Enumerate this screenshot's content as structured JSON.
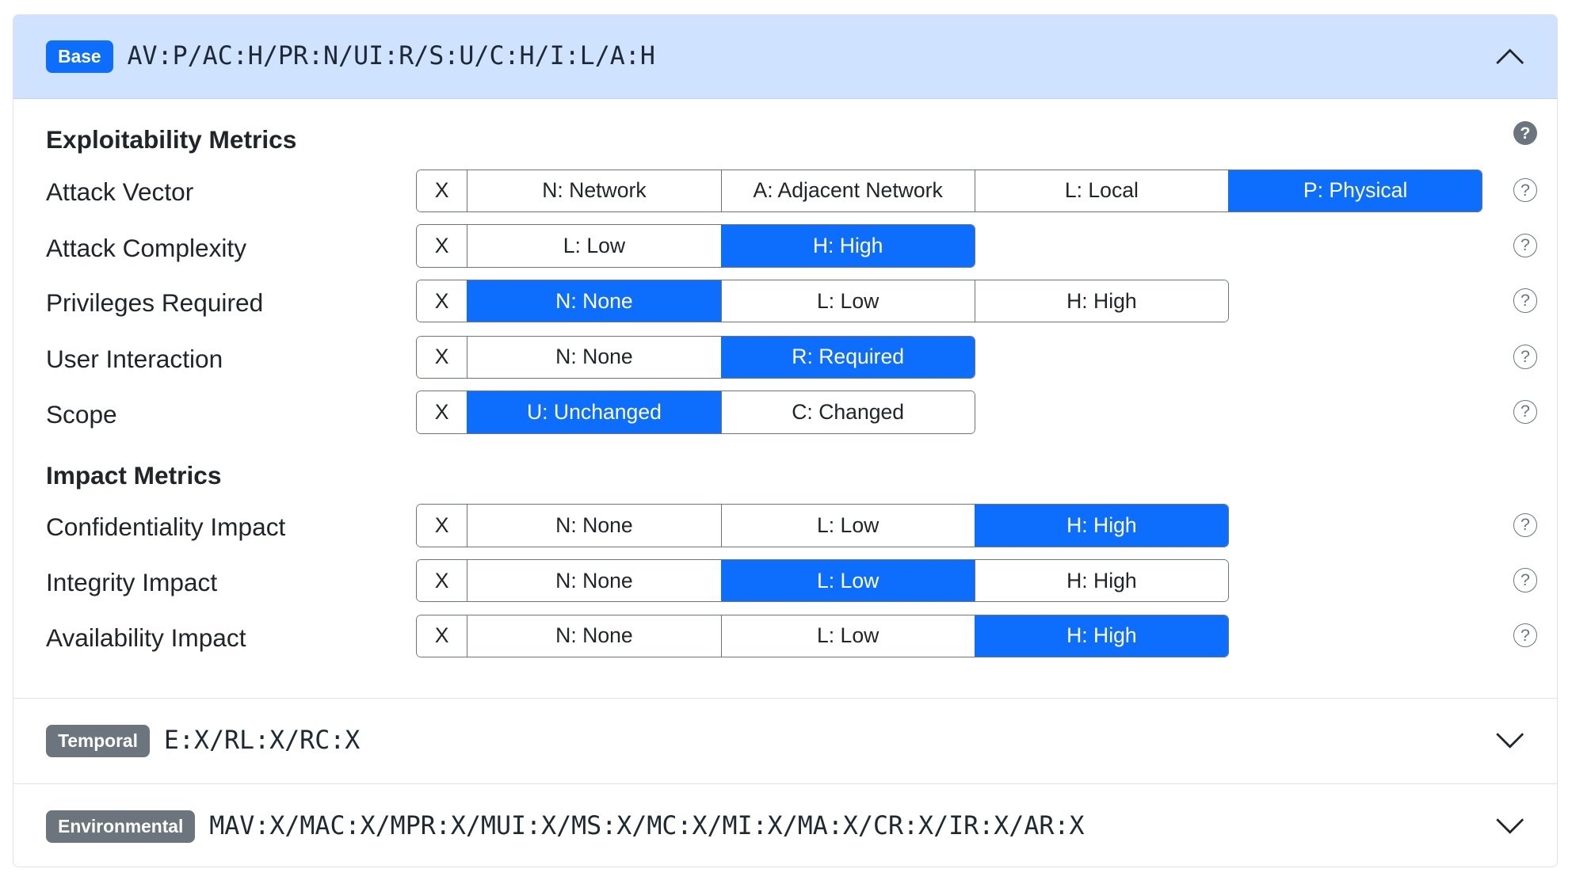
{
  "base": {
    "badge": "Base",
    "vector": "AV:P/AC:H/PR:N/UI:R/S:U/C:H/I:L/A:H",
    "expanded": true,
    "chevron_icon": "chevron-up-icon",
    "exploitability_title": "Exploitability Metrics",
    "impact_title": "Impact Metrics",
    "help_glyph": "?",
    "metrics": [
      {
        "label": "Attack Vector",
        "x": "X",
        "options": [
          "N: Network",
          "A: Adjacent Network",
          "L: Local",
          "P: Physical"
        ],
        "selected": 3
      },
      {
        "label": "Attack Complexity",
        "x": "X",
        "options": [
          "L: Low",
          "H: High"
        ],
        "selected": 1
      },
      {
        "label": "Privileges Required",
        "x": "X",
        "options": [
          "N: None",
          "L: Low",
          "H: High"
        ],
        "selected": 0
      },
      {
        "label": "User Interaction",
        "x": "X",
        "options": [
          "N: None",
          "R: Required"
        ],
        "selected": 1
      },
      {
        "label": "Scope",
        "x": "X",
        "options": [
          "U: Unchanged",
          "C: Changed"
        ],
        "selected": 0
      },
      {
        "label": "Confidentiality Impact",
        "x": "X",
        "options": [
          "N: None",
          "L: Low",
          "H: High"
        ],
        "selected": 2
      },
      {
        "label": "Integrity Impact",
        "x": "X",
        "options": [
          "N: None",
          "L: Low",
          "H: High"
        ],
        "selected": 1
      },
      {
        "label": "Availability Impact",
        "x": "X",
        "options": [
          "N: None",
          "L: Low",
          "H: High"
        ],
        "selected": 2
      }
    ]
  },
  "temporal": {
    "badge": "Temporal",
    "vector": "E:X/RL:X/RC:X",
    "expanded": false,
    "chevron_icon": "chevron-down-icon"
  },
  "environmental": {
    "badge": "Environmental",
    "vector": "MAV:X/MAC:X/MPR:X/MUI:X/MS:X/MC:X/MI:X/MA:X/CR:X/IR:X/AR:X",
    "expanded": false,
    "chevron_icon": "chevron-down-icon"
  },
  "colors": {
    "primary": "#0d6efd",
    "header_bg": "#cfe2ff",
    "secondary": "#6c757d"
  }
}
